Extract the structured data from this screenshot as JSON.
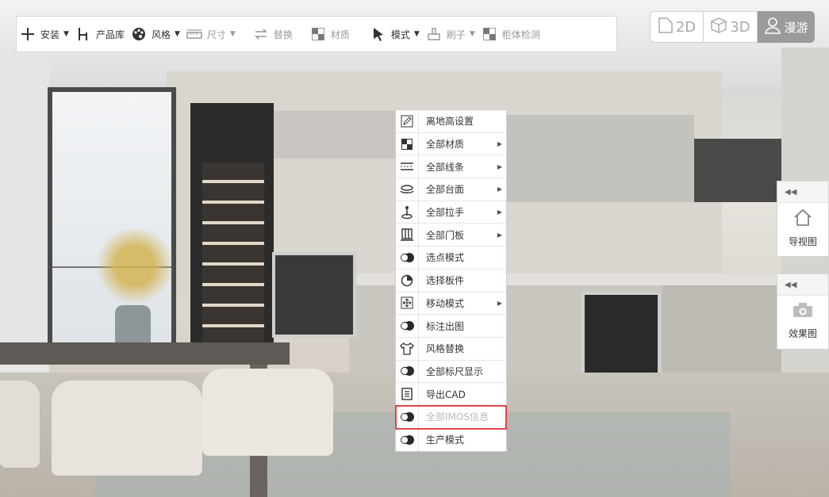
{
  "toolbar": {
    "items": [
      {
        "label": "安装",
        "icon": "plus-icon",
        "has_dropdown": true,
        "enabled": true
      },
      {
        "label": "产品库",
        "icon": "chair-icon",
        "has_dropdown": false,
        "enabled": true
      },
      {
        "label": "风格",
        "icon": "palette-icon",
        "has_dropdown": true,
        "enabled": true
      },
      {
        "label": "尺寸",
        "icon": "ruler-icon",
        "has_dropdown": true,
        "enabled": false
      },
      {
        "label": "替换",
        "icon": "swap-icon",
        "has_dropdown": false,
        "enabled": false
      },
      {
        "label": "材质",
        "icon": "checker-icon",
        "has_dropdown": false,
        "enabled": false
      },
      {
        "label": "模式",
        "icon": "cursor-icon",
        "has_dropdown": true,
        "enabled": true
      },
      {
        "label": "刷子",
        "icon": "brush-icon",
        "has_dropdown": true,
        "enabled": false
      },
      {
        "label": "柜体检测",
        "icon": "checker-icon",
        "has_dropdown": false,
        "enabled": false
      }
    ]
  },
  "view_switch": {
    "btn_2d": "2D",
    "btn_3d": "3D",
    "btn_roam": "漫游"
  },
  "context_menu": {
    "items": [
      {
        "label": "离地高设置",
        "icon": "edit-icon",
        "submenu": false
      },
      {
        "label": "全部材质",
        "icon": "checker-icon",
        "submenu": true
      },
      {
        "label": "全部线条",
        "icon": "lines-icon",
        "submenu": true
      },
      {
        "label": "全部台面",
        "icon": "countertop-icon",
        "submenu": true
      },
      {
        "label": "全部拉手",
        "icon": "handle-icon",
        "submenu": true
      },
      {
        "label": "全部门板",
        "icon": "door-panel-icon",
        "submenu": true
      },
      {
        "label": "选点模式",
        "icon": "toggle-icon",
        "submenu": false
      },
      {
        "label": "选择板件",
        "icon": "pie-icon",
        "submenu": false
      },
      {
        "label": "移动模式",
        "icon": "move-icon",
        "submenu": true
      },
      {
        "label": "标注出图",
        "icon": "toggle-icon",
        "submenu": false
      },
      {
        "label": "风格替换",
        "icon": "shirt-icon",
        "submenu": false
      },
      {
        "label": "全部标尺显示",
        "icon": "toggle-icon",
        "submenu": false
      },
      {
        "label": "导出CAD",
        "icon": "document-icon",
        "submenu": false
      },
      {
        "label": "全部IMOS信息",
        "icon": "toggle-icon",
        "submenu": false,
        "highlighted": true
      },
      {
        "label": "生产模式",
        "icon": "toggle-icon",
        "submenu": false
      }
    ]
  },
  "side_panels": {
    "nav": {
      "label": "导视图",
      "icon": "house-icon"
    },
    "effect": {
      "label": "效果图",
      "icon": "camera-icon"
    },
    "collapse_symbol": "◀◀"
  },
  "colors": {
    "highlight_border": "#e04646",
    "roam_bg": "#9b9b9b"
  }
}
